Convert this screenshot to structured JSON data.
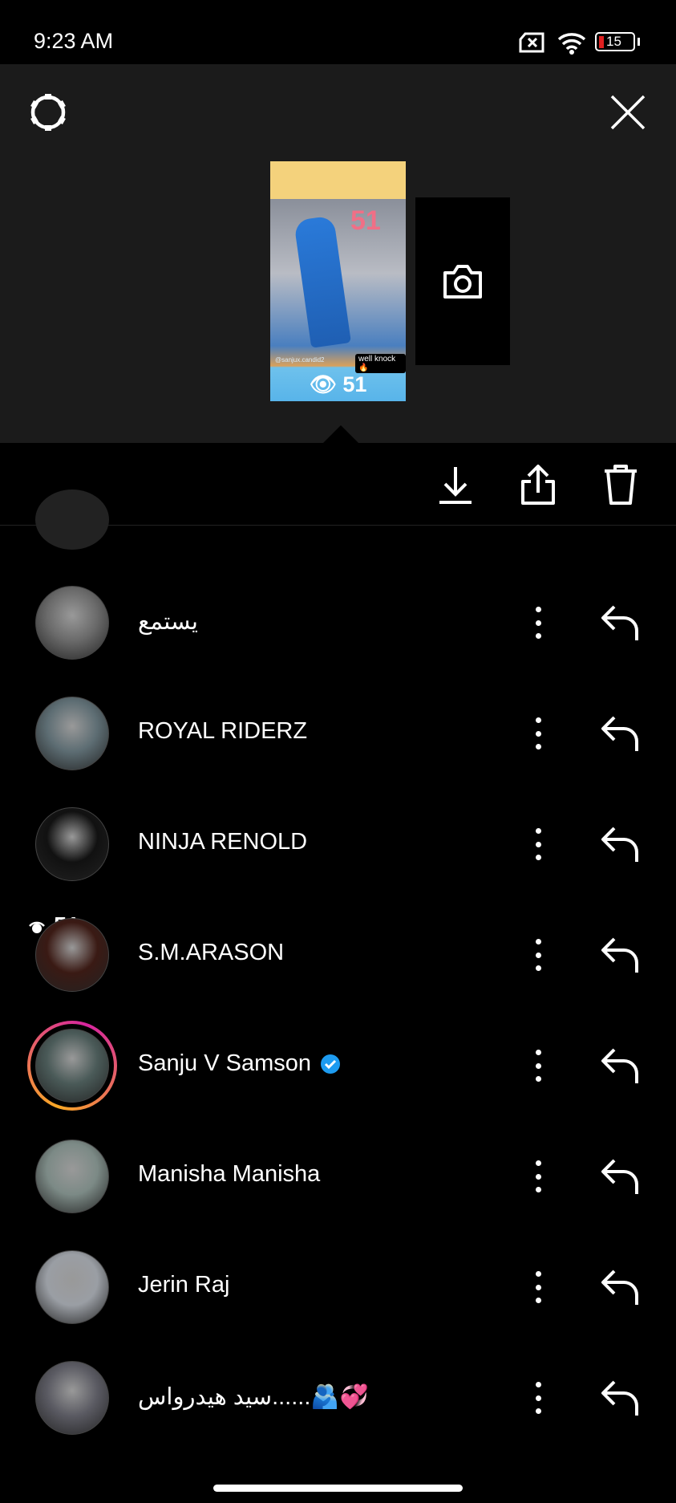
{
  "status_bar": {
    "time": "9:23 AM",
    "battery": "15"
  },
  "story": {
    "handle": "@sanjux.candid2",
    "sticker": "well knock 🔥",
    "overlay_number": "51",
    "views": "51"
  },
  "action_bar": {
    "views": "51"
  },
  "viewers": [
    {
      "name": "يستمع",
      "avatar": "#6a6a6a"
    },
    {
      "name": "ROYAL RIDERZ",
      "avatar": "#5d6d73"
    },
    {
      "name": "NINJA RENOLD",
      "avatar": "#111111"
    },
    {
      "name": "S.M.ARASON",
      "avatar": "#3a1a14"
    },
    {
      "name": "Sanju V Samson",
      "avatar": "#4a5a58",
      "verified": true,
      "story_ring": true
    },
    {
      "name": "Manisha Manisha",
      "avatar": "#7c8a86"
    },
    {
      "name": "Jerin Raj",
      "avatar": "#9a9ea4"
    },
    {
      "name": "سيد هيدرواس......🫂💞",
      "avatar": "#5a5a62"
    }
  ],
  "colors": {
    "verified": "#1d9bf0",
    "ring_start": "#f9a825",
    "ring_end": "#d6249f"
  }
}
